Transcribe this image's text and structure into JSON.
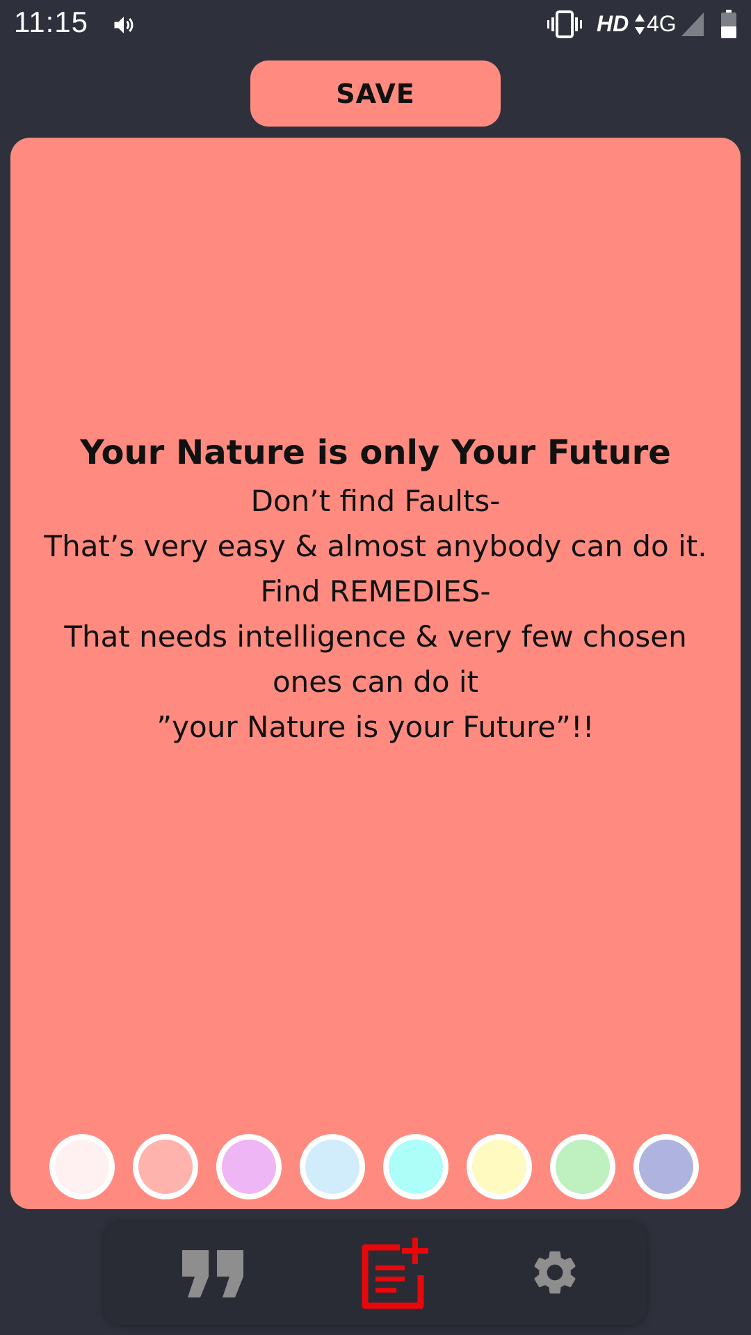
{
  "status_bar": {
    "time": "11:15",
    "network_label": "HD",
    "signal_label": "4G",
    "icons": [
      "volume-icon",
      "vibrate-icon",
      "data-arrows-icon",
      "signal-icon",
      "battery-icon"
    ]
  },
  "toolbar": {
    "save_label": "SAVE"
  },
  "quote": {
    "title": "Your Nature is only Your Future",
    "lines": [
      "Don’t find Faults-",
      "That’s very easy & almost anybody can do it.",
      "Find REMEDIES-",
      "That needs intelligence & very few chosen",
      "ones can do it",
      "”your Nature is your Future”!!"
    ],
    "background_color": "#ff8b80"
  },
  "color_options": [
    "#fff1f2",
    "#ffb3ac",
    "#efb6f6",
    "#d1ecfb",
    "#adfdf9",
    "#fffac0",
    "#bff0bf",
    "#aeb3e0"
  ],
  "bottom_nav": {
    "items": [
      {
        "icon": "quote-icon",
        "active": false
      },
      {
        "icon": "add-note-icon",
        "active": true
      },
      {
        "icon": "gear-icon",
        "active": false
      }
    ],
    "active_color": "#e8070a",
    "inactive_color": "#8e8e8e"
  },
  "colors": {
    "page_background": "#2e313c",
    "accent": "#ff8b80"
  }
}
